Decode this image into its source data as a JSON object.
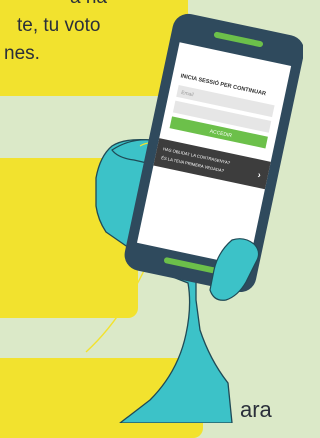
{
  "background_color": "#dbe9c8",
  "card_color": "#f2e22e",
  "top_card": {
    "line1": "a ha",
    "line2": "te, tu voto",
    "line3": "nes."
  },
  "bottom_card": {
    "text": "ara"
  },
  "phone": {
    "login_title": "INICIA SESSIÓ PER CONTINUAR",
    "email_placeholder": "Email",
    "password_placeholder": "",
    "submit_label": "ACCEDIR",
    "forgot_link": "HAS OBLIDAT LA CONTRASENYA?",
    "first_visit_link": "ÉS LA TEVA PRIMERA VEGADA?",
    "arrow": "›"
  },
  "colors": {
    "phone_body": "#2f4a5d",
    "screen": "#ffffff",
    "accent_green": "#6cc04a",
    "hand": "#3cc2c8",
    "footer_dark": "#3d3d3d"
  }
}
